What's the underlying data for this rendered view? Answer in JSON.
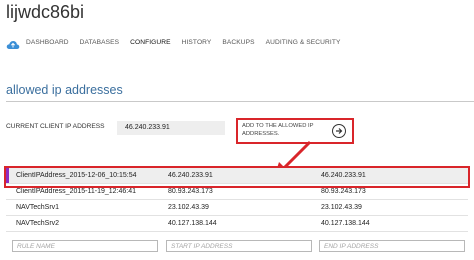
{
  "database": {
    "name": "lijwdc86bi"
  },
  "nav": {
    "items": [
      {
        "label": "DASHBOARD"
      },
      {
        "label": "DATABASES"
      },
      {
        "label": "CONFIGURE"
      },
      {
        "label": "HISTORY"
      },
      {
        "label": "BACKUPS"
      },
      {
        "label": "AUDITING & SECURITY"
      }
    ],
    "active": "CONFIGURE"
  },
  "section": {
    "title": "allowed ip addresses"
  },
  "client_ip": {
    "label": "CURRENT CLIENT IP ADDRESS",
    "value": "46.240.233.91",
    "add_label": "ADD TO THE ALLOWED IP ADDRESSES."
  },
  "rules": [
    {
      "name": "ClientIPAddress_2015-12-06_10:15:54",
      "start": "46.240.233.91",
      "end": "46.240.233.91",
      "highlighted": true
    },
    {
      "name": "ClientIPAddress_2015-11-19_12:46:41",
      "start": "80.93.243.173",
      "end": "80.93.243.173",
      "highlighted": false
    },
    {
      "name": "NAVTechSrv1",
      "start": "23.102.43.39",
      "end": "23.102.43.39",
      "highlighted": false
    },
    {
      "name": "NAVTechSrv2",
      "start": "40.127.138.144",
      "end": "40.127.138.144",
      "highlighted": false
    }
  ],
  "new_rule": {
    "name_placeholder": "RULE NAME",
    "start_placeholder": "START IP ADDRESS",
    "end_placeholder": "END IP ADDRESS"
  },
  "colors": {
    "highlight_red": "#d9252a",
    "row_marker": "#8e2bbf",
    "title_blue": "#3b6f9e",
    "cloud_blue": "#3b8fd6"
  },
  "icons": {
    "nav_icon": "cloud-icon",
    "add_icon": "arrow-right-circle-icon"
  }
}
